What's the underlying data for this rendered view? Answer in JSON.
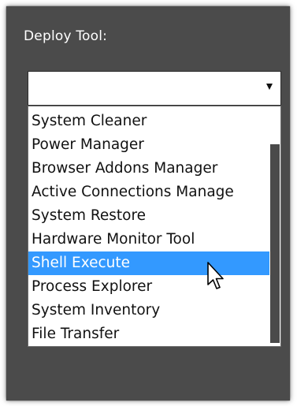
{
  "deploy_tool": {
    "label": "Deploy Tool:",
    "selected_value": "",
    "options": [
      "System Cleaner",
      "Power Manager",
      "Browser Addons Manager",
      "Active Connections Manage",
      "System Restore",
      "Hardware Monitor Tool",
      "Shell Execute",
      "Process Explorer",
      "System Inventory",
      "File Transfer"
    ],
    "highlighted_option": "Shell Execute"
  },
  "colors": {
    "panel_background": "#4b4b4b",
    "highlight": "#3399ff",
    "label_text": "#ffffff"
  },
  "icons": {
    "dropdown_arrow": "chevron-down-icon",
    "pointer": "mouse-pointer-icon"
  }
}
